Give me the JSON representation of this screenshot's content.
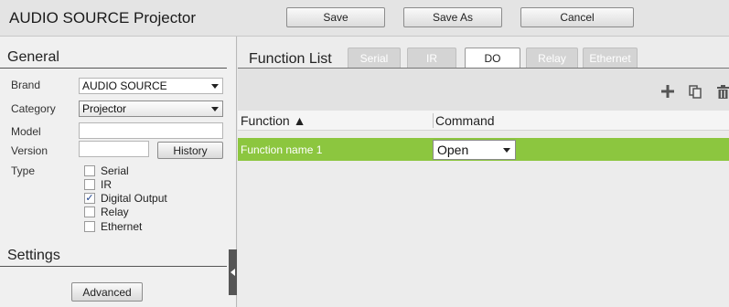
{
  "header": {
    "title": "AUDIO SOURCE Projector",
    "save_label": "Save",
    "save_as_label": "Save As",
    "cancel_label": "Cancel"
  },
  "general": {
    "section_title": "General",
    "brand_label": "Brand",
    "brand_value": "AUDIO SOURCE",
    "category_label": "Category",
    "category_value": "Projector",
    "model_label": "Model",
    "model_value": "",
    "version_label": "Version",
    "version_value": "",
    "history_label": "History",
    "type_label": "Type",
    "types": [
      {
        "label": "Serial",
        "checked": false
      },
      {
        "label": "IR",
        "checked": false
      },
      {
        "label": "Digital Output",
        "checked": true
      },
      {
        "label": "Relay",
        "checked": false
      },
      {
        "label": "Ethernet",
        "checked": false
      }
    ]
  },
  "settings": {
    "section_title": "Settings",
    "advanced_label": "Advanced"
  },
  "function_list": {
    "title": "Function List",
    "tabs": [
      {
        "label": "Serial",
        "active": false
      },
      {
        "label": "IR",
        "active": false
      },
      {
        "label": "DO",
        "active": true
      },
      {
        "label": "Relay",
        "active": false
      },
      {
        "label": "Ethernet",
        "active": false
      }
    ],
    "toolbar": {
      "add_icon": "plus-icon",
      "copy_icon": "copy-icon",
      "delete_icon": "trash-icon"
    },
    "columns": {
      "function": "Function ▲",
      "command": "Command"
    },
    "rows": [
      {
        "function": "Function name 1",
        "command": "Open",
        "selected": true
      }
    ]
  },
  "colors": {
    "selected_row": "#8cc63f",
    "inactive_tab": "#d4d4d4"
  }
}
